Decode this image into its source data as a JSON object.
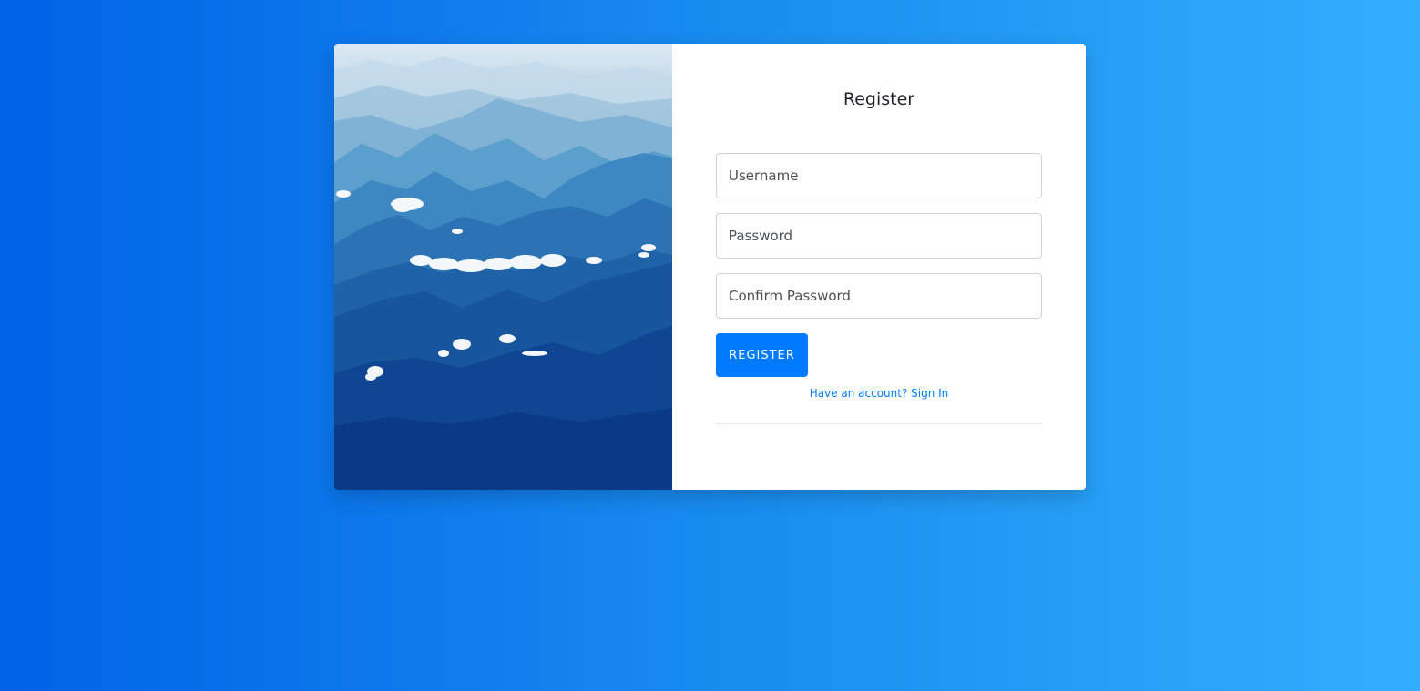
{
  "colors": {
    "background_gradient_start": "#0062e6",
    "background_gradient_end": "#33aefe",
    "primary": "#007bff",
    "card_background": "#ffffff"
  },
  "hero_image": {
    "description_icon": "mountain-landscape-image"
  },
  "form": {
    "title": "Register",
    "username_placeholder": "Username",
    "password_placeholder": "Password",
    "confirm_password_placeholder": "Confirm Password",
    "submit_label": "REGISTER",
    "signin_link": "Have an account? Sign In"
  }
}
